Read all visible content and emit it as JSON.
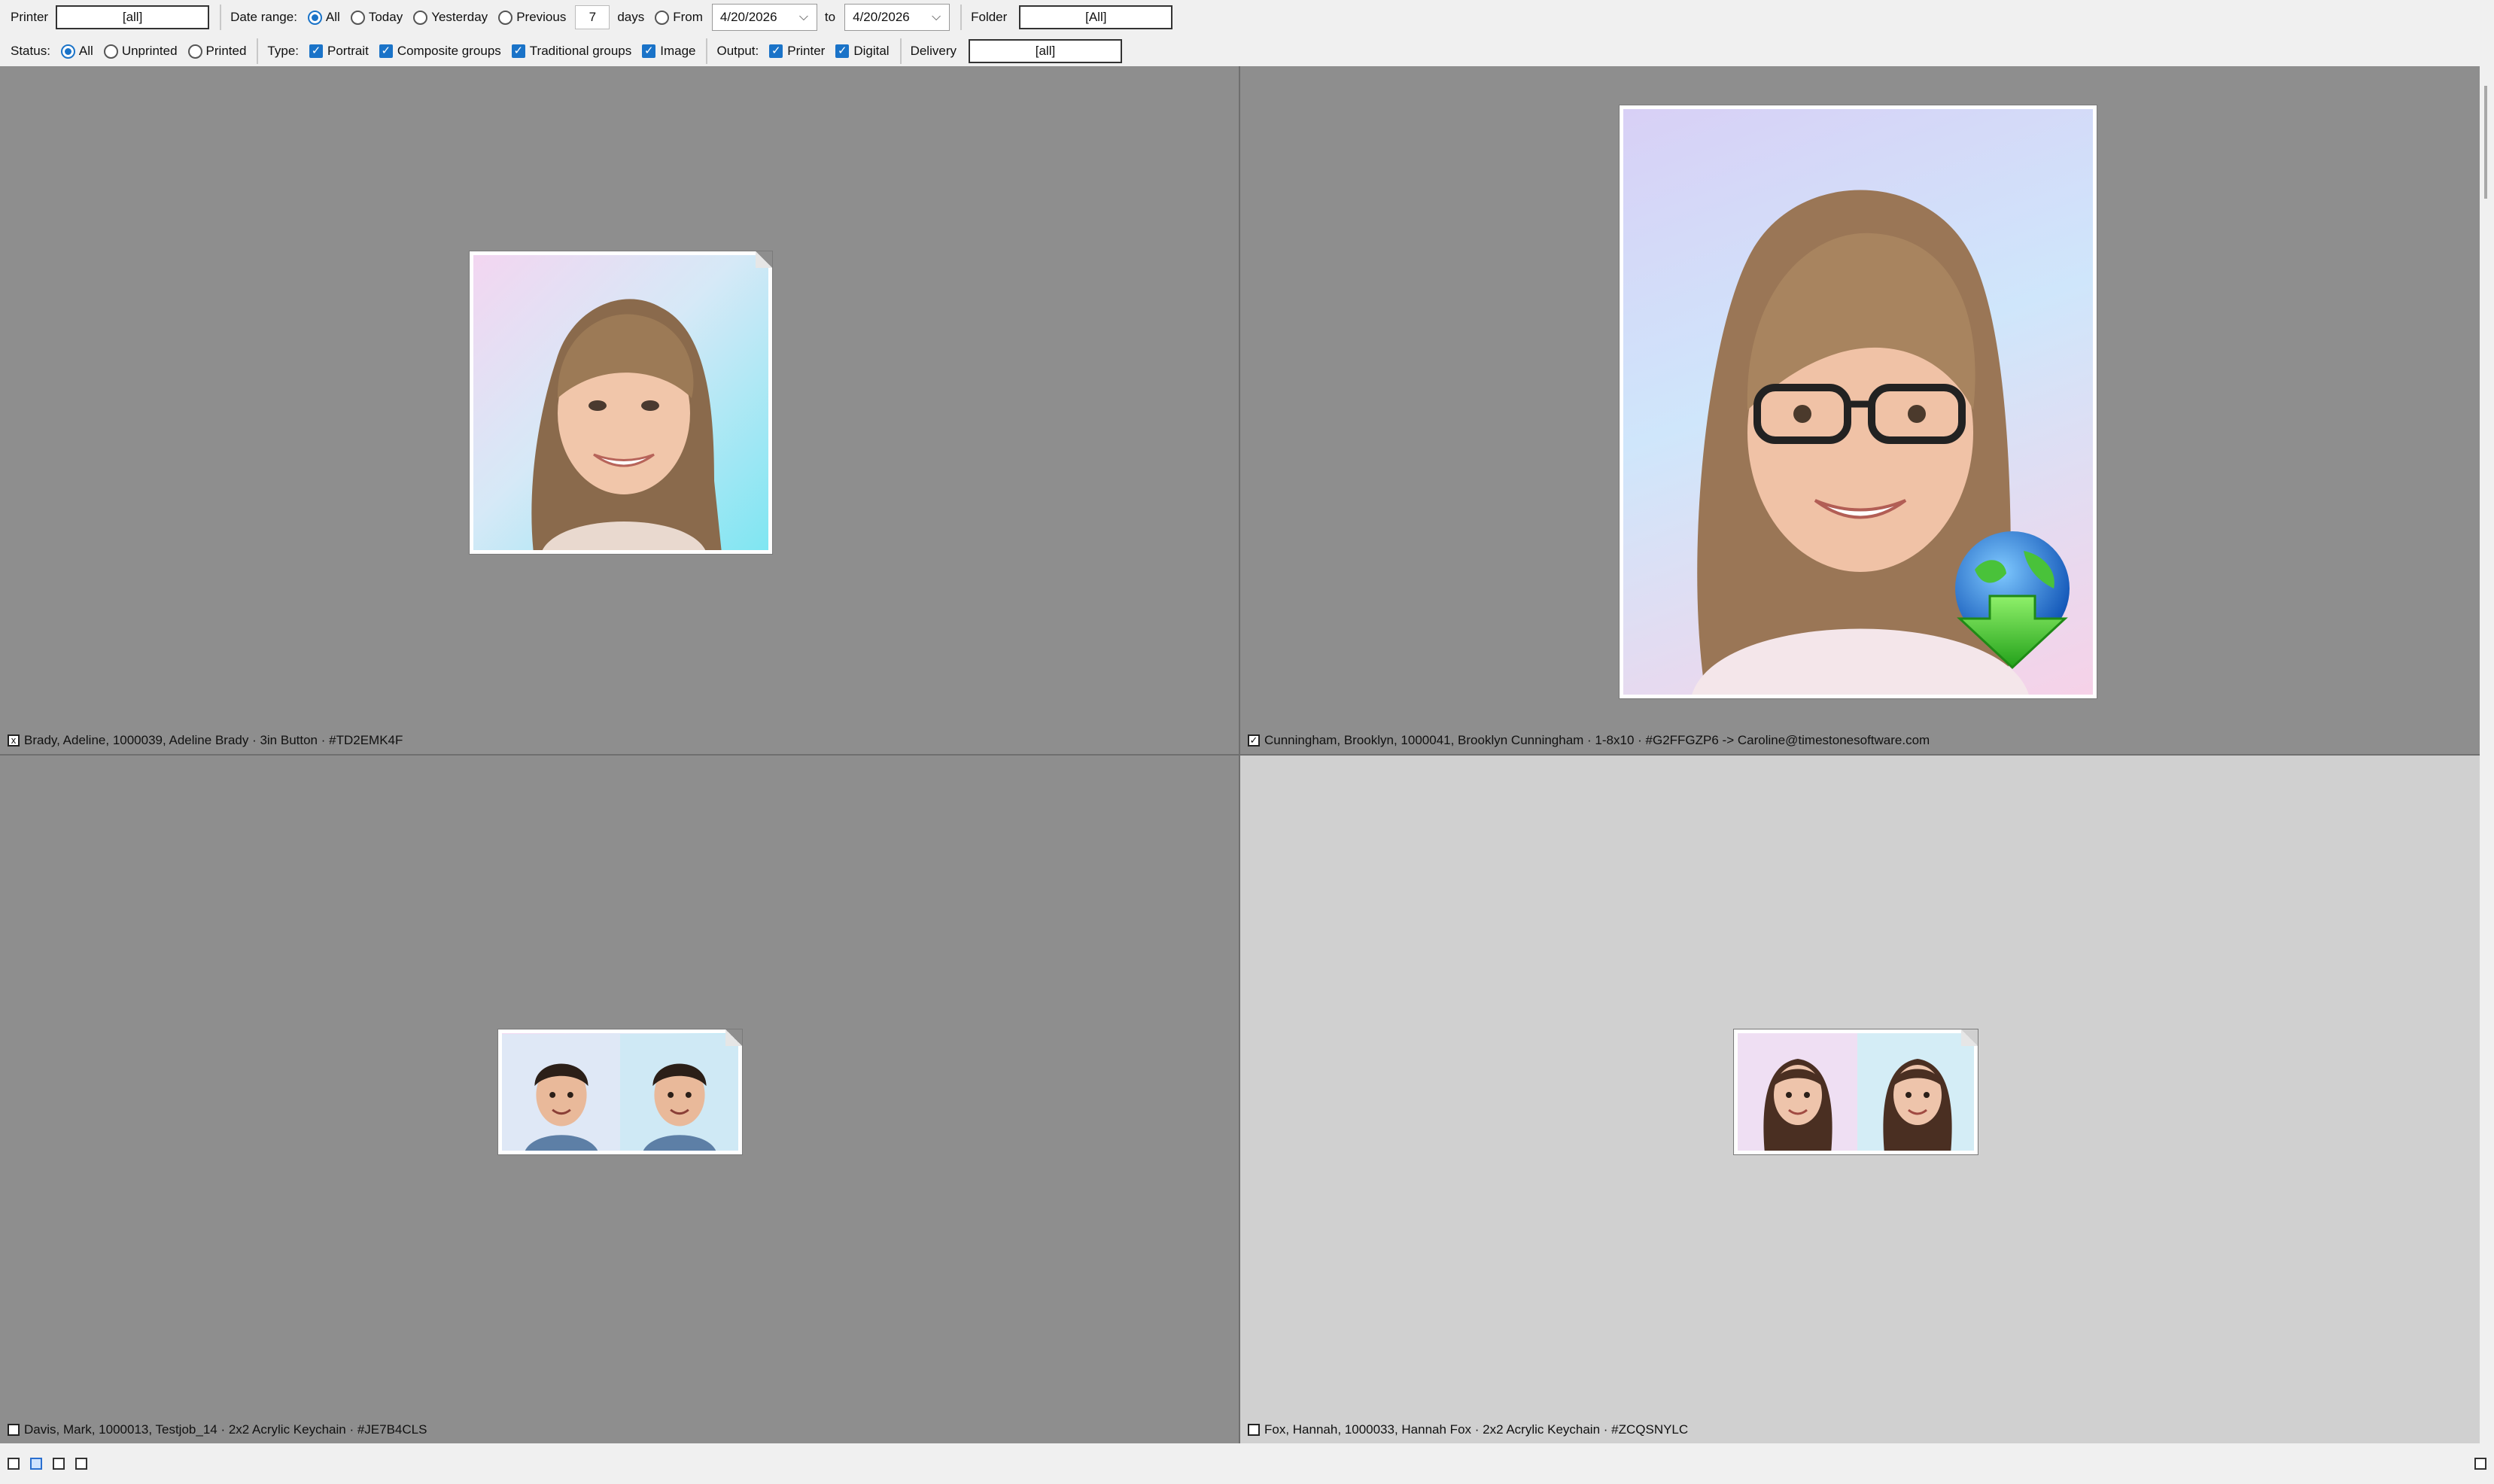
{
  "filters": {
    "printer_label": "Printer",
    "printer_value": "[all]",
    "date_range_label": "Date range:",
    "date_options": [
      "All",
      "Today",
      "Yesterday",
      "Previous"
    ],
    "days_value": "7",
    "days_label": "days",
    "from_label": "From",
    "date_from": "4/20/2026",
    "to_label": "to",
    "date_to": "4/20/2026",
    "folder_label": "Folder",
    "folder_value": "[All]",
    "status_label": "Status:",
    "status_options": [
      "All",
      "Unprinted",
      "Printed"
    ],
    "type_label": "Type:",
    "type_options": [
      "Portrait",
      "Composite groups",
      "Traditional groups",
      "Image"
    ],
    "output_label": "Output:",
    "output_options": [
      "Printer",
      "Digital"
    ],
    "delivery_label": "Delivery",
    "delivery_value": "[all]"
  },
  "orders": [
    {
      "caption": "Brady, Adeline, 1000039, Adeline Brady · 3in Button · #TD2EMK4F",
      "check": "x"
    },
    {
      "caption": "Cunningham, Brooklyn, 1000041, Brooklyn Cunningham · 1-8x10 · #G2FFGZP6 -> Caroline@timestonesoftware.com",
      "check": "✓"
    },
    {
      "caption": "Davis, Mark, 1000013, Testjob_14 · 2x2 Acrylic Keychain · #JE7B4CLS",
      "check": ""
    },
    {
      "caption": "Fox, Hannah, 1000033, Hannah Fox · 2x2 Acrylic Keychain · #ZCQSNYLC",
      "check": ""
    }
  ],
  "icons": {
    "digital_delivery": "globe-download-icon",
    "page_fold": "page-corner-fold-icon"
  },
  "colors": {
    "accent": "#1a73c8",
    "panel_bg": "#8e8e8e",
    "selected_panel_bg": "#d0d0d0"
  }
}
